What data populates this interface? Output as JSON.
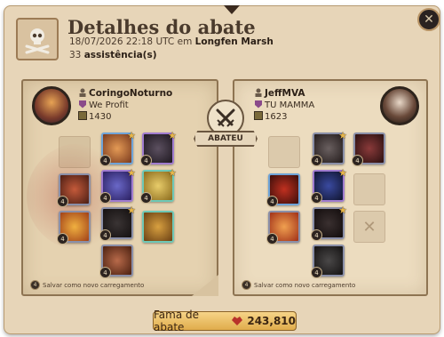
{
  "header": {
    "title": "Detalhes do abate",
    "datetime": "18/07/2026 22:18 UTC",
    "location_prefix": "em",
    "location": "Longfen Marsh",
    "assists_count": "33",
    "assists_label": "assistência(s)"
  },
  "killer": {
    "name": "CoringoNoturno",
    "guild": "We Profit",
    "item_power": "1430",
    "save_loadout_label": "Salvar como novo carregamento"
  },
  "victim": {
    "name": "JeffMVA",
    "guild": "TU MAMMA",
    "item_power": "1623",
    "save_loadout_label": "Salvar como novo carregamento"
  },
  "killed_label": "ABATEU",
  "fame": {
    "label": "Fama de abate",
    "value": "243,810"
  },
  "icons": {
    "header": "skull-crossbones-icon",
    "close": "close-icon",
    "killed": "crossed-swords-icon",
    "fame": "kill-fame-icon",
    "player": "player-icon",
    "guild": "guild-icon",
    "item_power": "item-power-icon"
  },
  "colors": {
    "fame_bar": "#e8b85c",
    "panel_left": "#e5d2b0",
    "panel_right": "#ecdcbf"
  },
  "item_tiers": {
    "killer": [
      "4",
      "4",
      "4",
      "4",
      "4",
      "4",
      "4",
      "4"
    ],
    "victim": [
      "4",
      "4",
      "4",
      "4",
      "4",
      "4",
      "4"
    ]
  }
}
